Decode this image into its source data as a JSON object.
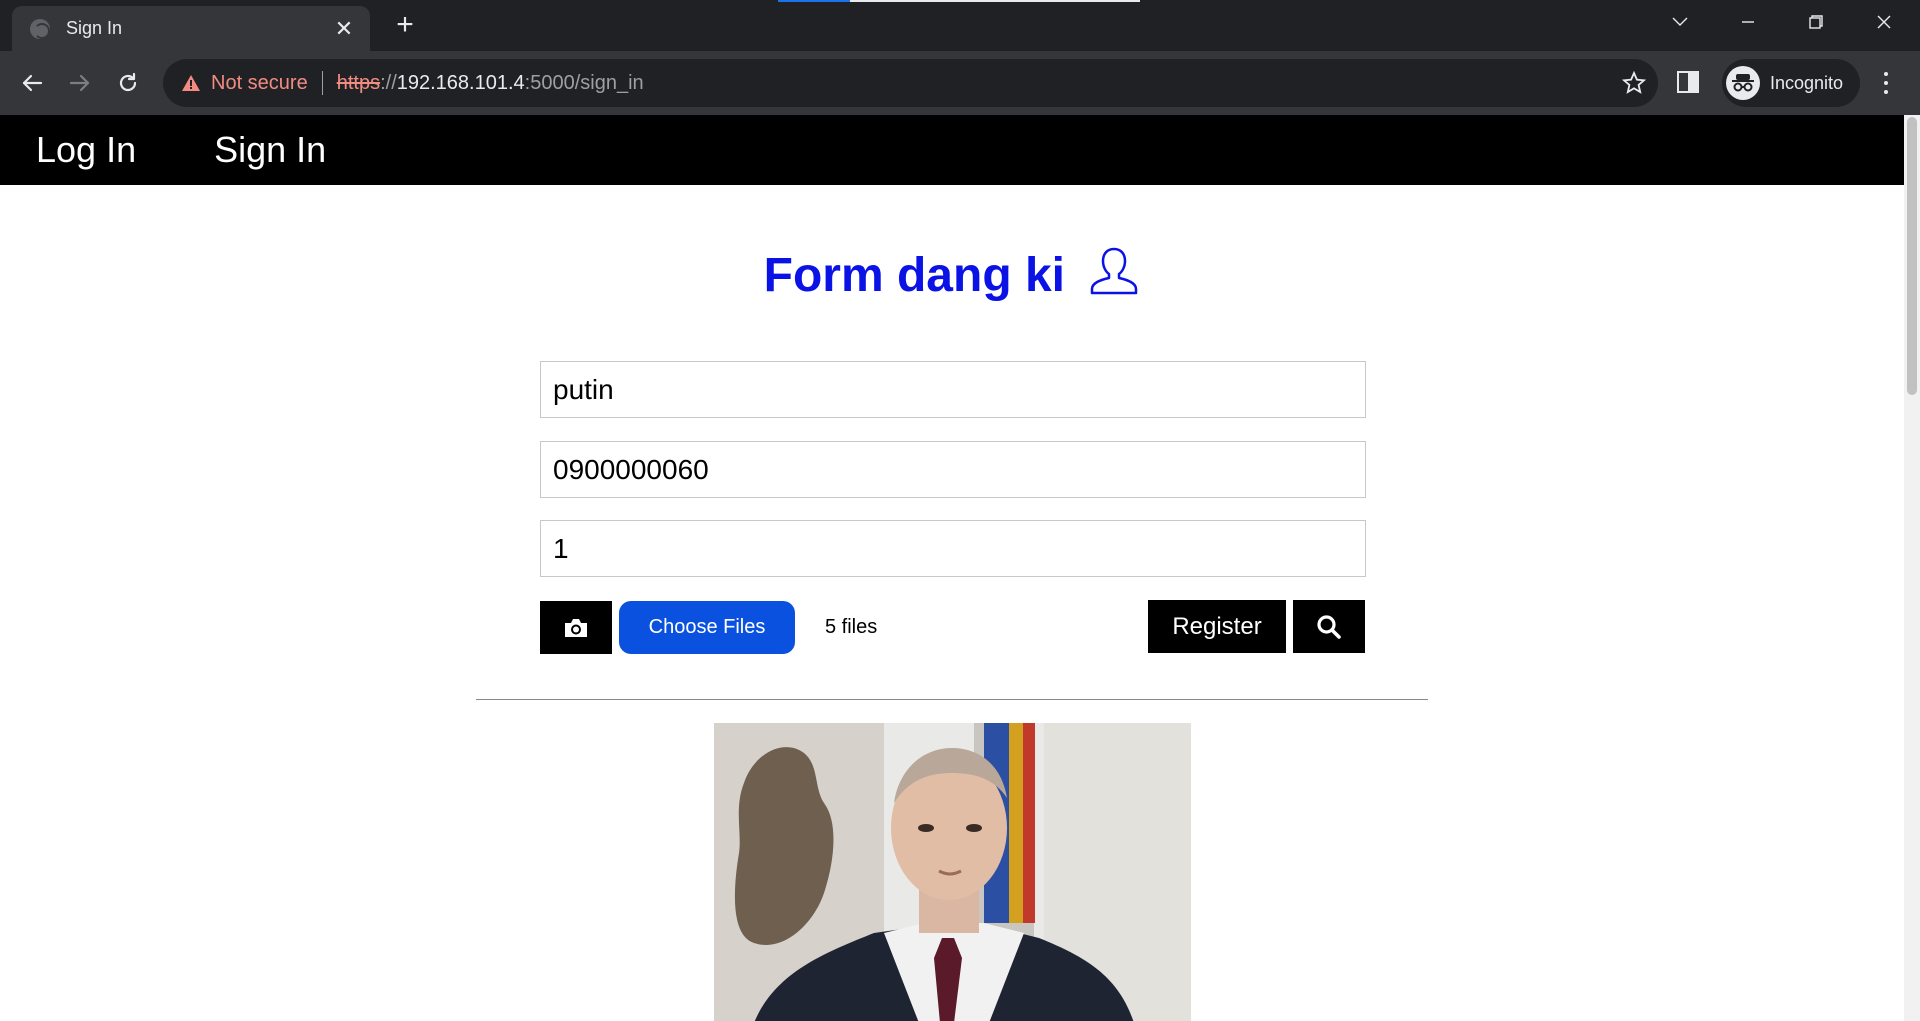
{
  "browser": {
    "tab_title": "Sign In",
    "tab_close": "✕",
    "new_tab": "+",
    "security_label": "Not secure",
    "url_scheme": "https",
    "url_sep": "://",
    "url_host": "192.168.101.4",
    "url_rest": ":5000/sign_in",
    "profile_label": "Incognito"
  },
  "nav": {
    "items": [
      {
        "label": "Log In"
      },
      {
        "label": "Sign In"
      }
    ]
  },
  "form": {
    "title": "Form dang ki",
    "name_value": "putin",
    "phone_value": "0900000060",
    "id_value": "1",
    "choose_files_label": "Choose Files",
    "files_status": "5 files",
    "register_label": "Register"
  },
  "colors": {
    "heading": "#0a12e6",
    "choose_files_bg": "#0b51e0",
    "nav_bg": "#000000"
  },
  "icons": {
    "camera": "camera-icon",
    "search": "search-icon",
    "user": "user-icon"
  }
}
